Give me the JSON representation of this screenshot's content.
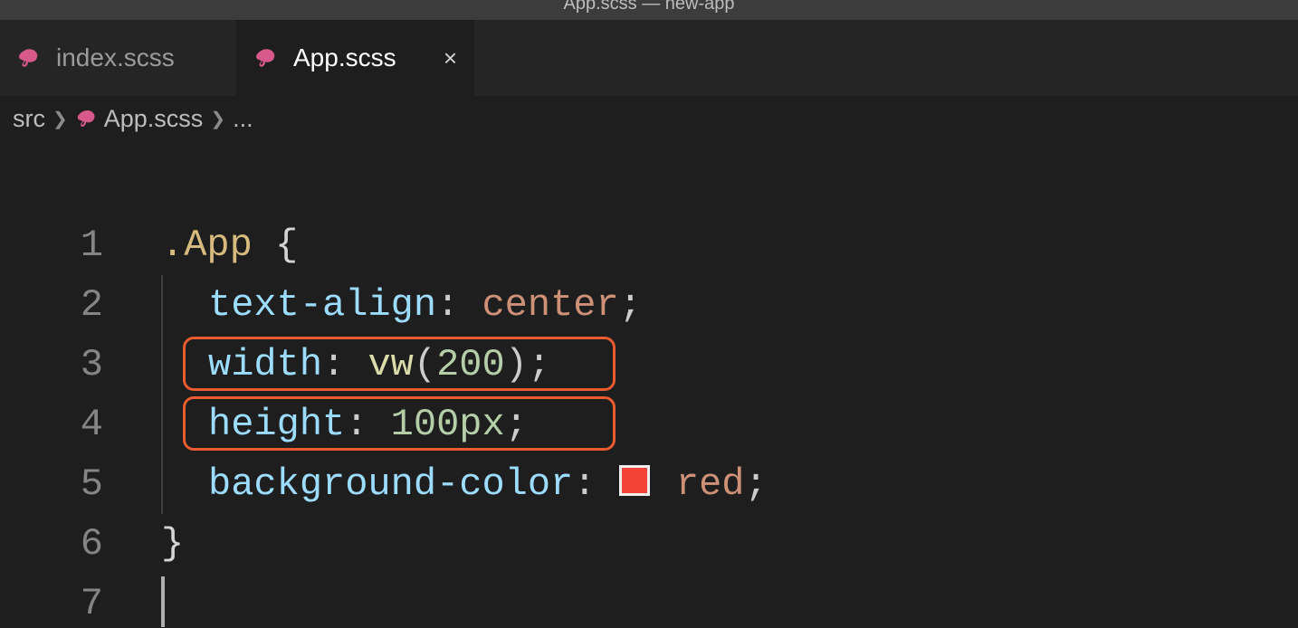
{
  "window": {
    "title": "App.scss — new-app"
  },
  "tabs": [
    {
      "label": "index.scss",
      "active": false
    },
    {
      "label": "App.scss",
      "active": true
    }
  ],
  "breadcrumb": {
    "segments": [
      "src",
      "App.scss",
      "..."
    ]
  },
  "colors": {
    "swatch_red": "#f44336",
    "highlight_border": "#ea5b30"
  },
  "code": {
    "line_numbers": [
      "1",
      "2",
      "3",
      "4",
      "5",
      "6",
      "7"
    ],
    "lines": [
      {
        "tokens": [
          {
            "t": ".App ",
            "c": "tk-selector"
          },
          {
            "t": "{",
            "c": "tk-brace"
          }
        ]
      },
      {
        "indent": 1,
        "tokens": [
          {
            "t": "text-align",
            "c": "tk-prop"
          },
          {
            "t": ": ",
            "c": "tk-punc"
          },
          {
            "t": "center",
            "c": "tk-value"
          },
          {
            "t": ";",
            "c": "tk-punc"
          }
        ]
      },
      {
        "indent": 1,
        "highlight": true,
        "tokens": [
          {
            "t": "width",
            "c": "tk-prop"
          },
          {
            "t": ": ",
            "c": "tk-punc"
          },
          {
            "t": "vw",
            "c": "tk-func"
          },
          {
            "t": "(",
            "c": "tk-paren"
          },
          {
            "t": "200",
            "c": "tk-num"
          },
          {
            "t": ")",
            "c": "tk-paren"
          },
          {
            "t": ";",
            "c": "tk-punc"
          }
        ]
      },
      {
        "indent": 1,
        "highlight": true,
        "tokens": [
          {
            "t": "height",
            "c": "tk-prop"
          },
          {
            "t": ": ",
            "c": "tk-punc"
          },
          {
            "t": "100px",
            "c": "tk-num"
          },
          {
            "t": ";",
            "c": "tk-punc"
          }
        ]
      },
      {
        "indent": 1,
        "tokens": [
          {
            "t": "background-color",
            "c": "tk-prop"
          },
          {
            "t": ": ",
            "c": "tk-punc"
          },
          {
            "swatch": "colors.swatch_red"
          },
          {
            "t": " red",
            "c": "tk-value"
          },
          {
            "t": ";",
            "c": "tk-punc"
          }
        ]
      },
      {
        "tokens": [
          {
            "t": "}",
            "c": "tk-brace"
          }
        ]
      },
      {
        "cursor": true,
        "tokens": []
      }
    ]
  }
}
